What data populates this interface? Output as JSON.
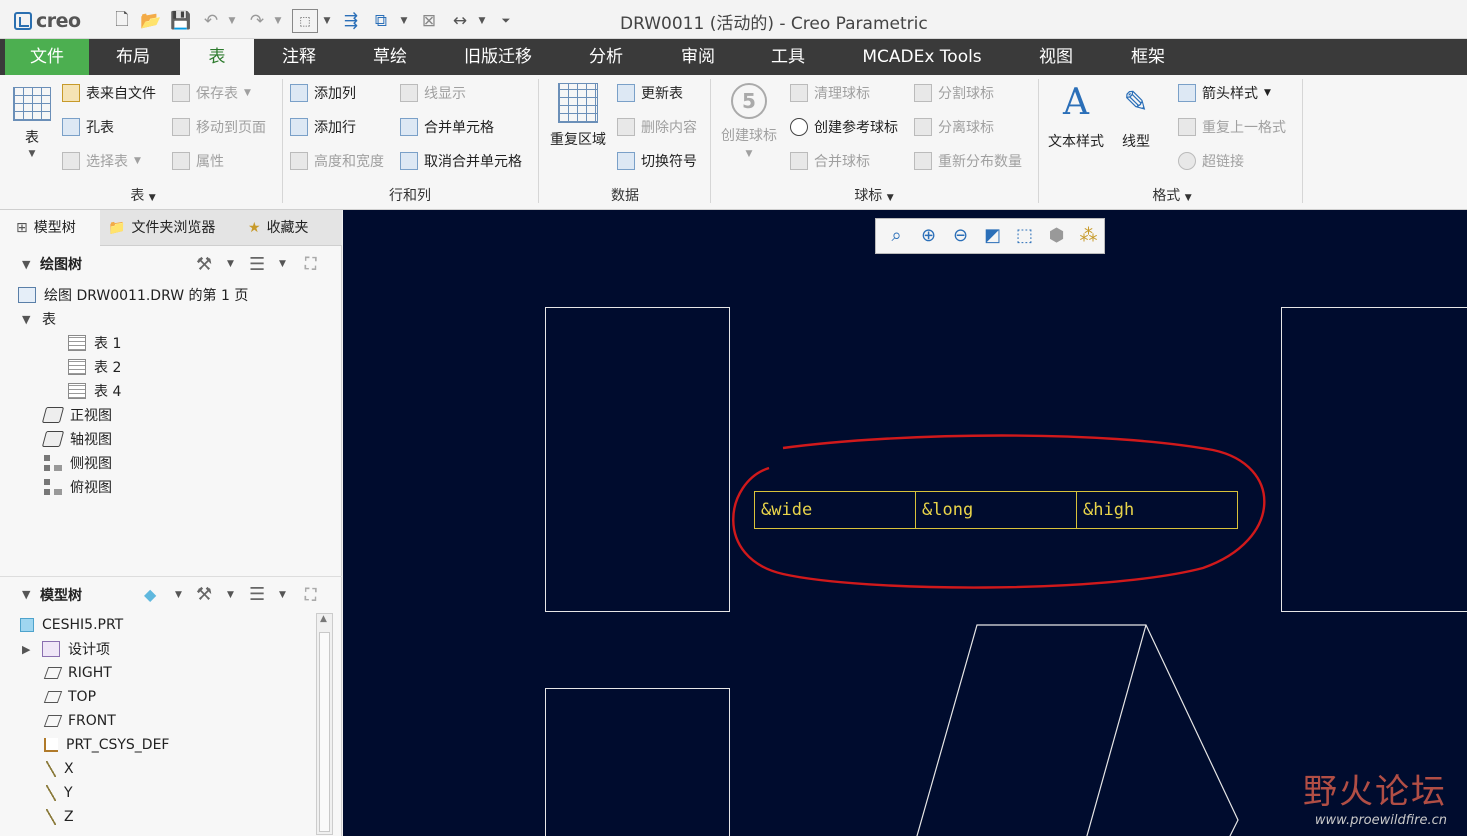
{
  "window": {
    "title": "DRW0011 (活动的) - Creo Parametric",
    "app": "creo"
  },
  "quick_access": [
    "new-icon",
    "open-icon",
    "save-icon",
    "undo-icon",
    "redo-icon",
    "select-box-icon",
    "regenerate-icon",
    "windows-icon",
    "close-window-icon",
    "dimension-icon",
    "customize-icon"
  ],
  "menu": {
    "file": "文件",
    "tabs": [
      "布局",
      "表",
      "注释",
      "草绘",
      "旧版迁移",
      "分析",
      "审阅",
      "工具",
      "MCADEx Tools",
      "视图",
      "框架"
    ],
    "active": "表"
  },
  "ribbon": {
    "table_group": {
      "label": "表",
      "big_button": "表",
      "items": [
        {
          "label": "表来自文件",
          "enabled": true
        },
        {
          "label": "保存表",
          "enabled": false
        },
        {
          "label": "孔表",
          "enabled": true
        },
        {
          "label": "移动到页面",
          "enabled": false
        },
        {
          "label": "选择表",
          "enabled": false
        },
        {
          "label": "属性",
          "enabled": false
        }
      ]
    },
    "rows_cols_group": {
      "label": "行和列",
      "items": [
        {
          "label": "添加列",
          "enabled": true
        },
        {
          "label": "线显示",
          "enabled": false
        },
        {
          "label": "添加行",
          "enabled": true
        },
        {
          "label": "合并单元格",
          "enabled": true
        },
        {
          "label": "高度和宽度",
          "enabled": false
        },
        {
          "label": "取消合并单元格",
          "enabled": true
        }
      ]
    },
    "data_group": {
      "label": "数据",
      "big_button": "重复区域",
      "items": [
        {
          "label": "更新表",
          "enabled": true
        },
        {
          "label": "删除内容",
          "enabled": false
        },
        {
          "label": "切换符号",
          "enabled": true
        }
      ]
    },
    "balloon_group": {
      "label": "球标",
      "big_button": "创建球标",
      "big_enabled": false,
      "items": [
        {
          "label": "清理球标",
          "enabled": false
        },
        {
          "label": "分割球标",
          "enabled": false
        },
        {
          "label": "创建参考球标",
          "enabled": true
        },
        {
          "label": "分离球标",
          "enabled": false
        },
        {
          "label": "合并球标",
          "enabled": false
        },
        {
          "label": "重新分布数量",
          "enabled": false
        }
      ]
    },
    "format_group": {
      "label": "格式",
      "big_buttons": [
        "文本样式",
        "线型"
      ],
      "items": [
        {
          "label": "箭头样式",
          "enabled": true
        },
        {
          "label": "重复上一格式",
          "enabled": false
        },
        {
          "label": "超链接",
          "enabled": false
        }
      ]
    }
  },
  "panel": {
    "tabs": [
      "模型树",
      "文件夹浏览器",
      "收藏夹"
    ],
    "drawing_tree": {
      "header": "绘图树",
      "sheet": "绘图 DRW0011.DRW 的第 1 页",
      "tables_node": "表",
      "tables": [
        "表 1",
        "表 2",
        "表 4"
      ],
      "views": [
        "正视图",
        "轴视图",
        "侧视图",
        "俯视图"
      ]
    },
    "model_tree": {
      "header": "模型树",
      "items": [
        "CESHI5.PRT",
        "设计项",
        "RIGHT",
        "TOP",
        "FRONT",
        "PRT_CSYS_DEF",
        "X",
        "Y",
        "Z"
      ]
    }
  },
  "canvas": {
    "view_toolbar": [
      "refit-icon",
      "zoom-in-icon",
      "zoom-out-icon",
      "repaint-icon",
      "display-style-icon",
      "saved-views-icon",
      "annotation-display-icon"
    ],
    "table_cells": [
      "&wide",
      "&long",
      "&high"
    ],
    "colors": {
      "background": "#000c2e",
      "table_text": "#e8d44a",
      "highlight": "#d0191b"
    }
  },
  "watermark": {
    "main": "野火论坛",
    "url": "www.proewildfire.cn"
  }
}
